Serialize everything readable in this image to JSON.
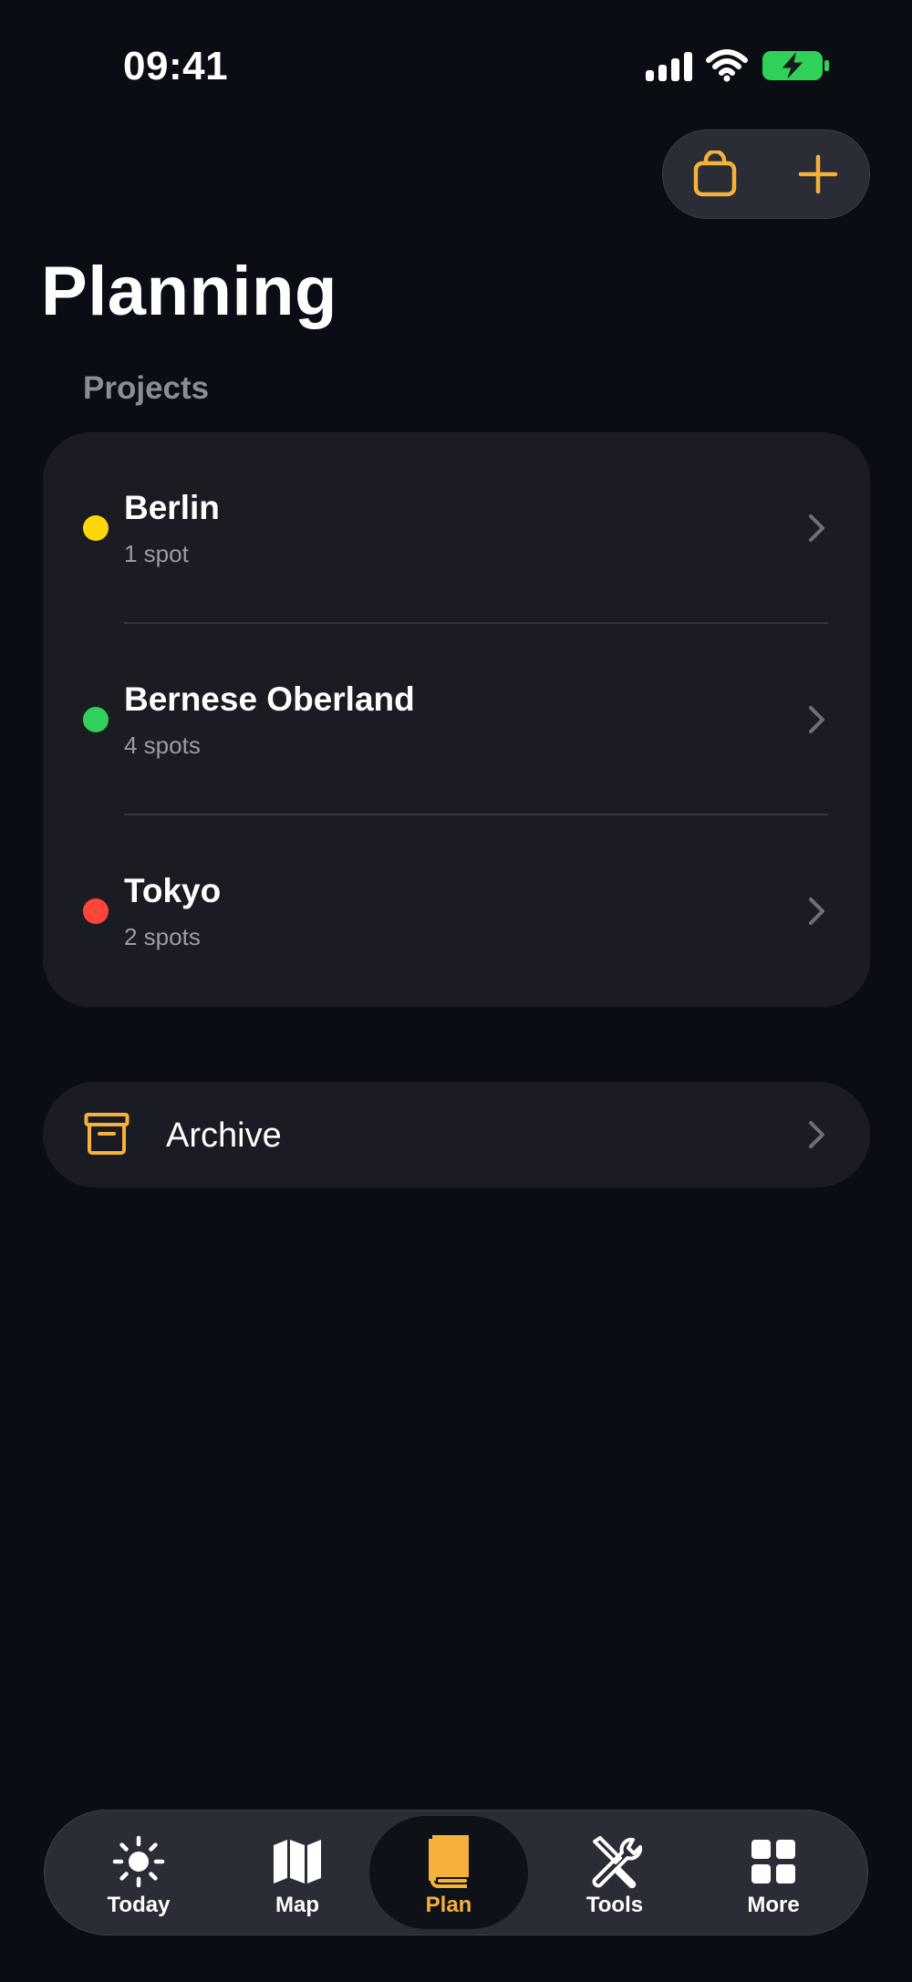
{
  "status_bar": {
    "time": "09:41"
  },
  "header": {
    "title": "Planning"
  },
  "projects": {
    "section_label": "Projects",
    "items": [
      {
        "name": "Berlin",
        "count": "1 spot",
        "color": "#ffd60a"
      },
      {
        "name": "Bernese Oberland",
        "count": "4 spots",
        "color": "#30d158"
      },
      {
        "name": "Tokyo",
        "count": "2 spots",
        "color": "#ff453a"
      }
    ]
  },
  "archive": {
    "label": "Archive"
  },
  "tab_bar": {
    "tabs": [
      {
        "label": "Today",
        "icon": "sun-icon"
      },
      {
        "label": "Map",
        "icon": "map-icon"
      },
      {
        "label": "Plan",
        "icon": "book-icon",
        "active": true
      },
      {
        "label": "Tools",
        "icon": "tools-icon"
      },
      {
        "label": "More",
        "icon": "grid-icon"
      }
    ]
  },
  "colors": {
    "accent": "#f5b13a",
    "battery": "#30d158",
    "background": "#0a0d14",
    "card": "#1b1c23"
  }
}
